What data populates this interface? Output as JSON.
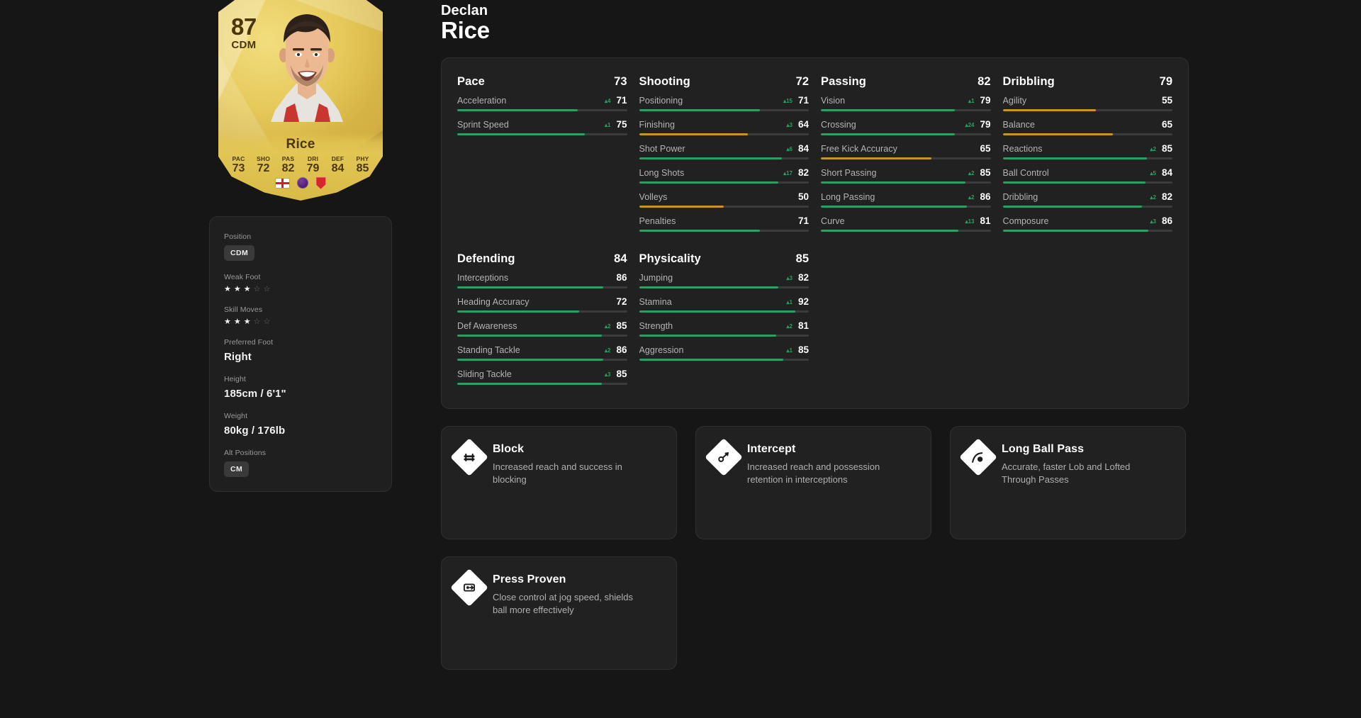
{
  "player": {
    "first_name": "Declan",
    "last_name": "Rice",
    "rating": "87",
    "position": "CDM",
    "card_name": "Rice",
    "card_stats": [
      {
        "label": "PAC",
        "value": "73"
      },
      {
        "label": "SHO",
        "value": "72"
      },
      {
        "label": "PAS",
        "value": "82"
      },
      {
        "label": "DRI",
        "value": "79"
      },
      {
        "label": "DEF",
        "value": "84"
      },
      {
        "label": "PHY",
        "value": "85"
      }
    ],
    "badges": [
      "england-flag-icon",
      "premier-league-icon",
      "arsenal-crest-icon"
    ]
  },
  "info": {
    "position": {
      "label": "Position",
      "value": "CDM"
    },
    "weak_foot": {
      "label": "Weak Foot",
      "stars": 3,
      "max": 5
    },
    "skill_moves": {
      "label": "Skill Moves",
      "stars": 3,
      "max": 5
    },
    "preferred_foot": {
      "label": "Preferred Foot",
      "value": "Right"
    },
    "height": {
      "label": "Height",
      "value": "185cm / 6'1\""
    },
    "weight": {
      "label": "Weight",
      "value": "80kg / 176lb"
    },
    "alt_positions": {
      "label": "Alt Positions",
      "value": "CM"
    }
  },
  "colors": {
    "green": "#2f9e63",
    "gold": "#c8951f",
    "red": "#d96a6a",
    "track": "#3b3b3b",
    "panel": "#212121",
    "page": "#161616"
  },
  "stat_groups": [
    {
      "name": "Pace",
      "value": "73",
      "stats": [
        {
          "label": "Acceleration",
          "value": 71,
          "delta": "4",
          "dir": "up"
        },
        {
          "label": "Sprint Speed",
          "value": 75,
          "delta": "1",
          "dir": "up"
        }
      ]
    },
    {
      "name": "Shooting",
      "value": "72",
      "stats": [
        {
          "label": "Positioning",
          "value": 71,
          "delta": "15",
          "dir": "up"
        },
        {
          "label": "Finishing",
          "value": 64,
          "delta": "3",
          "dir": "up"
        },
        {
          "label": "Shot Power",
          "value": 84,
          "delta": "6",
          "dir": "up"
        },
        {
          "label": "Long Shots",
          "value": 82,
          "delta": "17",
          "dir": "up"
        },
        {
          "label": "Volleys",
          "value": 50,
          "delta": "",
          "dir": ""
        },
        {
          "label": "Penalties",
          "value": 71,
          "delta": "",
          "dir": ""
        }
      ]
    },
    {
      "name": "Passing",
      "value": "82",
      "stats": [
        {
          "label": "Vision",
          "value": 79,
          "delta": "1",
          "dir": "up"
        },
        {
          "label": "Crossing",
          "value": 79,
          "delta": "24",
          "dir": "up"
        },
        {
          "label": "Free Kick Accuracy",
          "value": 65,
          "delta": "",
          "dir": ""
        },
        {
          "label": "Short Passing",
          "value": 85,
          "delta": "2",
          "dir": "up"
        },
        {
          "label": "Long Passing",
          "value": 86,
          "delta": "2",
          "dir": "up"
        },
        {
          "label": "Curve",
          "value": 81,
          "delta": "13",
          "dir": "up"
        }
      ]
    },
    {
      "name": "Dribbling",
      "value": "79",
      "stats": [
        {
          "label": "Agility",
          "value": 55,
          "delta": "",
          "dir": ""
        },
        {
          "label": "Balance",
          "value": 65,
          "delta": "",
          "dir": ""
        },
        {
          "label": "Reactions",
          "value": 85,
          "delta": "2",
          "dir": "up"
        },
        {
          "label": "Ball Control",
          "value": 84,
          "delta": "5",
          "dir": "up"
        },
        {
          "label": "Dribbling",
          "value": 82,
          "delta": "2",
          "dir": "up"
        },
        {
          "label": "Composure",
          "value": 86,
          "delta": "3",
          "dir": "up"
        }
      ]
    },
    {
      "name": "Defending",
      "value": "84",
      "stats": [
        {
          "label": "Interceptions",
          "value": 86,
          "delta": "",
          "dir": ""
        },
        {
          "label": "Heading Accuracy",
          "value": 72,
          "delta": "",
          "dir": ""
        },
        {
          "label": "Def Awareness",
          "value": 85,
          "delta": "2",
          "dir": "up"
        },
        {
          "label": "Standing Tackle",
          "value": 86,
          "delta": "2",
          "dir": "up"
        },
        {
          "label": "Sliding Tackle",
          "value": 85,
          "delta": "3",
          "dir": "up"
        }
      ]
    },
    {
      "name": "Physicality",
      "value": "85",
      "stats": [
        {
          "label": "Jumping",
          "value": 82,
          "delta": "3",
          "dir": "up"
        },
        {
          "label": "Stamina",
          "value": 92,
          "delta": "1",
          "dir": "up"
        },
        {
          "label": "Strength",
          "value": 81,
          "delta": "2",
          "dir": "up"
        },
        {
          "label": "Aggression",
          "value": 85,
          "delta": "1",
          "dir": "up"
        }
      ]
    }
  ],
  "playstyles": [
    {
      "name": "Block",
      "desc": "Increased reach and success in blocking",
      "icon": "block-playstyle-icon"
    },
    {
      "name": "Intercept",
      "desc": "Increased reach and possession retention in interceptions",
      "icon": "intercept-playstyle-icon"
    },
    {
      "name": "Long Ball Pass",
      "desc": "Accurate, faster Lob and Lofted Through Passes",
      "icon": "long-ball-pass-playstyle-icon"
    },
    {
      "name": "Press Proven",
      "desc": "Close control at jog speed, shields ball more effectively",
      "icon": "press-proven-playstyle-icon"
    }
  ]
}
